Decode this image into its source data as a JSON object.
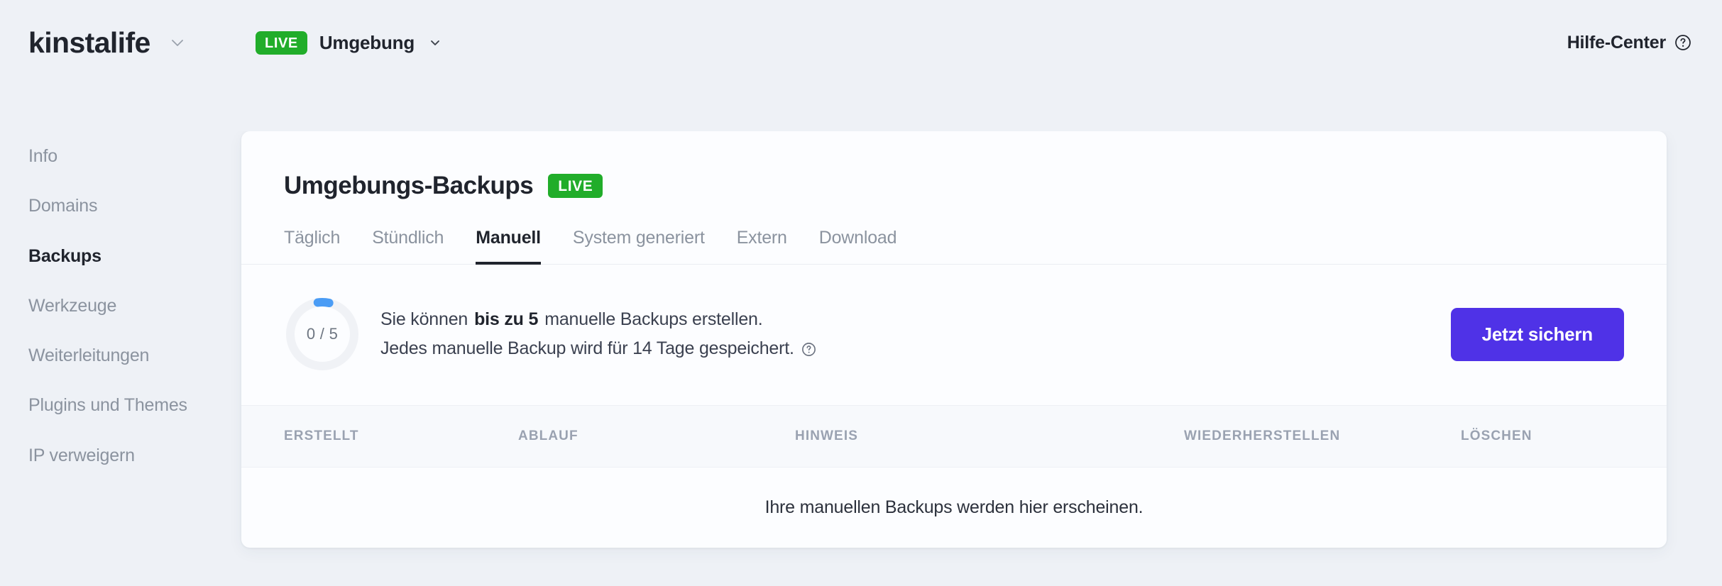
{
  "header": {
    "brand": "kinstalife",
    "brand_caret_icon": "chevron-down-icon",
    "env_badge": "LIVE",
    "env_label": "Umgebung",
    "env_caret_icon": "chevron-down-icon",
    "help_center": "Hilfe-Center",
    "help_icon": "question-circle-icon"
  },
  "sidebar": {
    "items": [
      {
        "label": "Info",
        "active": false
      },
      {
        "label": "Domains",
        "active": false
      },
      {
        "label": "Backups",
        "active": true
      },
      {
        "label": "Werkzeuge",
        "active": false
      },
      {
        "label": "Weiterleitungen",
        "active": false
      },
      {
        "label": "Plugins und Themes",
        "active": false
      },
      {
        "label": "IP verweigern",
        "active": false
      }
    ]
  },
  "main": {
    "title": "Umgebungs-Backups",
    "title_badge": "LIVE",
    "tabs": [
      {
        "label": "Täglich",
        "active": false
      },
      {
        "label": "Stündlich",
        "active": false
      },
      {
        "label": "Manuell",
        "active": true
      },
      {
        "label": "System generiert",
        "active": false
      },
      {
        "label": "Extern",
        "active": false
      },
      {
        "label": "Download",
        "active": false
      }
    ],
    "quota": {
      "used": 0,
      "total": 5,
      "ring_label": "0 / 5",
      "line1_prefix": "Sie können ",
      "line1_strong": "bis zu 5",
      "line1_suffix": " manuelle Backups erstellen.",
      "line2": "Jedes manuelle Backup wird für 14 Tage gespeichert.",
      "line2_help_icon": "question-circle-icon",
      "action_button": "Jetzt sichern"
    },
    "table": {
      "columns": [
        "ERSTELLT",
        "ABLAUF",
        "HINWEIS",
        "WIEDERHERSTELLEN",
        "LÖSCHEN"
      ],
      "rows": [],
      "empty_message": "Ihre manuellen Backups werden hier erscheinen."
    }
  },
  "colors": {
    "accent_purple": "#4f32e7",
    "live_green": "#21ad2a",
    "ring_progress_blue": "#4a9cf5",
    "ring_track": "#f0f2f6",
    "page_bg": "#eef1f6",
    "card_bg": "#fcfdff"
  }
}
